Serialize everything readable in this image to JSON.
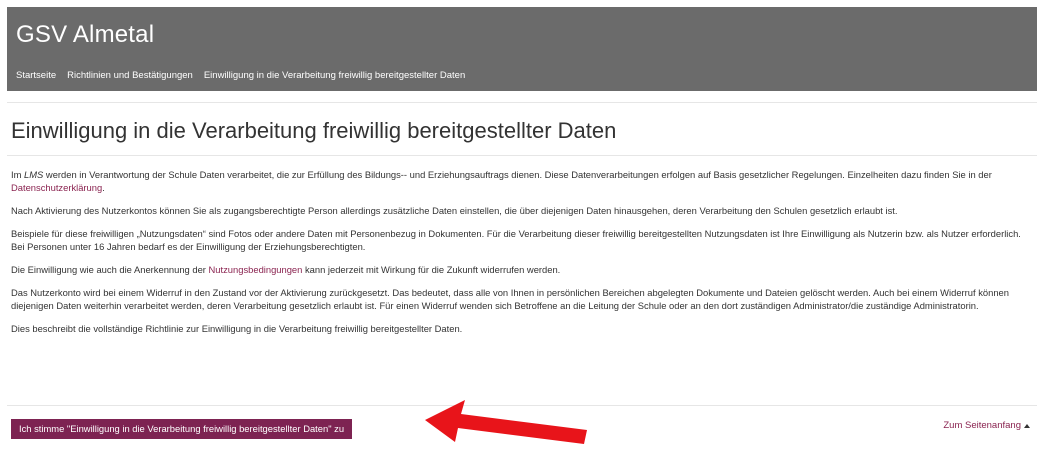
{
  "header": {
    "site_title": "GSV Almetal",
    "breadcrumb": [
      "Startseite",
      "Richtlinien und Bestätigungen",
      "Einwilligung in die Verarbeitung freiwillig bereitgestellter Daten"
    ]
  },
  "page": {
    "title": "Einwilligung in die Verarbeitung freiwillig bereitgestellter Daten"
  },
  "content": {
    "p1_a": "Im ",
    "p1_lms": "LMS",
    "p1_b": " werden in Verantwortung der Schule Daten verarbeitet, die zur Erfüllung des Bildungs-- und Erziehungsauftrags dienen. Diese Datenverarbeitungen erfolgen auf Basis gesetzlicher Regelungen. Einzelheiten dazu finden Sie in der ",
    "p1_link": "Datenschutzerklärung",
    "p1_c": ".",
    "p2": "Nach Aktivierung des Nutzerkontos können Sie als zugangsberechtigte Person allerdings zusätzliche Daten einstellen, die über diejenigen Daten hinausgehen, deren Verarbeitung den Schulen gesetzlich erlaubt ist.",
    "p3": "Beispiele für diese freiwilligen „Nutzungsdaten“ sind Fotos oder andere Daten mit Personenbezug in Dokumenten. Für die Verarbeitung dieser freiwillig bereitgestellten Nutzungsdaten ist Ihre Einwilligung als Nutzerin bzw. als Nutzer erforderlich. Bei Personen unter 16 Jahren bedarf es der Einwilligung der Erziehungsberechtigten.",
    "p4_a": "Die Einwilligung wie auch die Anerkennung der ",
    "p4_link": "Nutzungsbedingungen",
    "p4_b": " kann jederzeit mit Wirkung für die Zukunft widerrufen werden.",
    "p5": "Das Nutzerkonto wird bei einem Widerruf in den Zustand vor der Aktivierung zurückgesetzt. Das bedeutet, dass alle von Ihnen in persönlichen Bereichen abgelegten Dokumente und Dateien gelöscht werden. Auch bei einem Widerruf können diejenigen Daten weiterhin verarbeitet werden, deren Verarbeitung gesetzlich erlaubt ist. Für einen Widerruf wenden sich Betroffene an die Leitung der Schule oder an den dort zuständigen Administrator/die zuständige Administratorin.",
    "p6": "Dies beschreibt die vollständige Richtlinie zur Einwilligung in die Verarbeitung freiwillig bereitgestellter Daten."
  },
  "footer": {
    "accept_label": "Ich stimme \"Einwilligung in die Verarbeitung freiwillig bereitgestellter Daten\" zu",
    "to_top_label": "Zum Seitenanfang"
  },
  "colors": {
    "header_bg": "#6b6b6b",
    "accent": "#7d2352",
    "arrow": "#e8141a"
  }
}
